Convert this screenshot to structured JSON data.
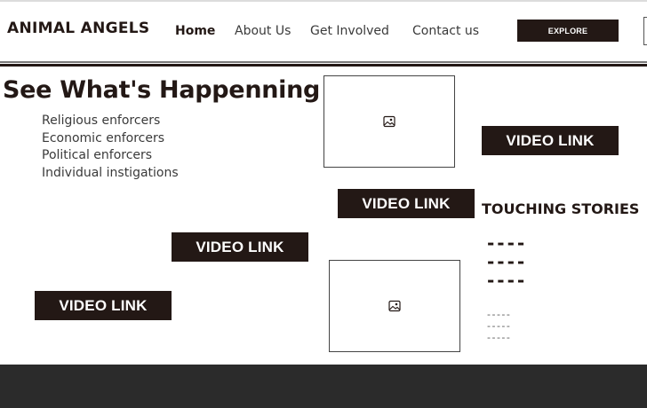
{
  "header": {
    "logo": "ANIMAL ANGELS",
    "nav": [
      {
        "label": "Home",
        "active": true
      },
      {
        "label": "About Us",
        "active": false
      },
      {
        "label": "Get Involved",
        "active": false
      },
      {
        "label": "Contact us",
        "active": false
      }
    ],
    "explore_label": "EXPLORE"
  },
  "main": {
    "title": "See What's Happenning",
    "list": [
      "Religious enforcers",
      "Economic enforcers",
      "Political enforcers",
      "Individual instigations"
    ],
    "video_label": "VIDEO LINK",
    "stories_title": "TOUCHING STORIES",
    "dashes_big": "----",
    "dashes_small": "-----"
  },
  "colors": {
    "dark": "#231815",
    "footer": "#2b2b2b"
  },
  "icons": {
    "image_placeholder": "image-icon"
  }
}
